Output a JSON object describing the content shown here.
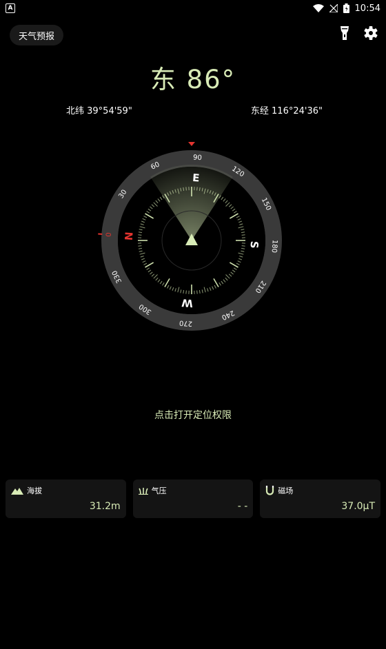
{
  "status_bar": {
    "time": "10:54",
    "app_badge": "A"
  },
  "header": {
    "weather_button": "天气预报"
  },
  "heading": {
    "direction": "东",
    "degrees": "86°"
  },
  "coordinates": {
    "latitude": "北纬 39°54'59\"",
    "longitude": "东经 116°24'36\""
  },
  "compass": {
    "cardinals": {
      "E": "E",
      "S": "S",
      "W": "W",
      "N": "N"
    },
    "degree_labels": [
      "90",
      "120",
      "150",
      "180",
      "210",
      "240",
      "270",
      "300",
      "330",
      "0",
      "30",
      "60"
    ],
    "heading_value": 86
  },
  "location_prompt": "点击打开定位权限",
  "cards": [
    {
      "label": "海拔",
      "value": "31.2m",
      "icon": "mountain-icon"
    },
    {
      "label": "气压",
      "value": "- -",
      "icon": "pressure-icon"
    },
    {
      "label": "磁场",
      "value": "37.0μT",
      "icon": "magnet-icon"
    }
  ],
  "colors": {
    "accent": "#d8ebb6",
    "north_red": "#e3342f",
    "background": "#000000"
  }
}
